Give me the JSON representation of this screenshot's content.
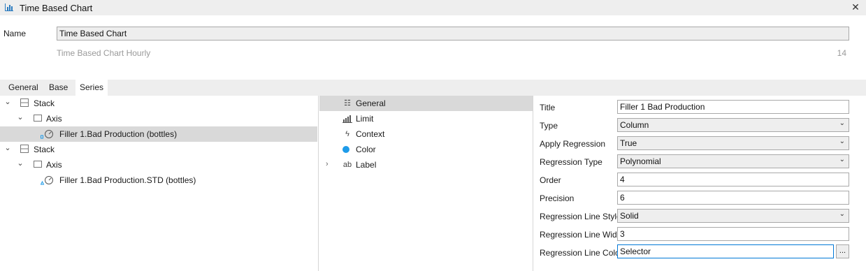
{
  "window": {
    "title": "Time Based Chart",
    "icon": "bar-chart-icon",
    "close_icon": "close-icon",
    "close_glyph": "✕"
  },
  "name_section": {
    "label": "Name",
    "value": "Time Based Chart",
    "subtitle": "Time Based Chart Hourly",
    "count": "14"
  },
  "tabs": [
    {
      "label": "General",
      "active": false
    },
    {
      "label": "Base",
      "active": false
    },
    {
      "label": "Series",
      "active": true
    }
  ],
  "tree": [
    {
      "label": "Stack",
      "level": 0,
      "expanded": true,
      "icon": "stack-icon"
    },
    {
      "label": "Axis",
      "level": 1,
      "expanded": true,
      "icon": "axis-icon"
    },
    {
      "label": "Filler 1.Bad Production (bottles)",
      "level": 2,
      "selected": true,
      "icon": "gauge-icon"
    },
    {
      "label": "Stack",
      "level": 0,
      "expanded": true,
      "icon": "stack-icon"
    },
    {
      "label": "Axis",
      "level": 1,
      "expanded": true,
      "icon": "axis-icon"
    },
    {
      "label": "Filler 1.Bad Production.STD (bottles)",
      "level": 2,
      "selected": false,
      "icon": "gauge-icon"
    }
  ],
  "categories": [
    {
      "label": "General",
      "icon": "list-icon",
      "glyph": "☷",
      "selected": true
    },
    {
      "label": "Limit",
      "icon": "limit-icon",
      "glyph": "⋮",
      "selected": false
    },
    {
      "label": "Context",
      "icon": "lightning-icon",
      "glyph": "ϟ",
      "selected": false
    },
    {
      "label": "Color",
      "icon": "color-dot-icon",
      "glyph": "",
      "selected": false
    },
    {
      "label": "Label",
      "icon": "text-ab-icon",
      "glyph": "ab",
      "selected": false,
      "expandable": true
    }
  ],
  "properties": [
    {
      "label": "Title",
      "value": "Filler 1 Bad Production",
      "kind": "text"
    },
    {
      "label": "Type",
      "value": "Column",
      "kind": "select"
    },
    {
      "label": "Apply Regression",
      "value": "True",
      "kind": "select"
    },
    {
      "label": "Regression Type",
      "value": "Polynomial",
      "kind": "select"
    },
    {
      "label": "Order",
      "value": "4",
      "kind": "text"
    },
    {
      "label": "Precision",
      "value": "6",
      "kind": "text"
    },
    {
      "label": "Regression Line Style",
      "value": "Solid",
      "kind": "select"
    },
    {
      "label": "Regression Line Width",
      "value": "3",
      "kind": "text"
    },
    {
      "label": "Regression Line Color",
      "value": "Selector",
      "kind": "color",
      "button": "..."
    }
  ],
  "colors": {
    "selection": "#d9d9d9",
    "accent": "#1e9be9",
    "chrome": "#eeeeee"
  }
}
